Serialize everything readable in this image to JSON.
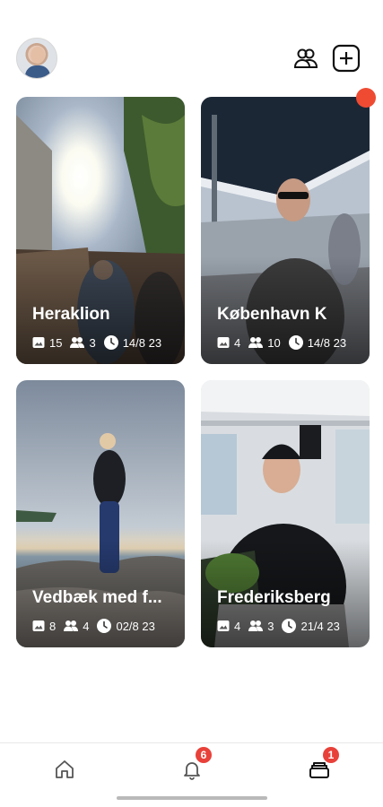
{
  "header": {
    "avatar_icon": "profile-avatar",
    "friends_icon": "people-icon",
    "add_icon": "plus-square-icon"
  },
  "albums": [
    {
      "title": "Heraklion",
      "photos": "15",
      "people": "3",
      "date": "14/8 23"
    },
    {
      "title": "København K",
      "photos": "4",
      "people": "10",
      "date": "14/8 23",
      "unread": true
    },
    {
      "title": "Vedbæk med f...",
      "photos": "8",
      "people": "4",
      "date": "02/8 23"
    },
    {
      "title": "Frederiksberg",
      "photos": "4",
      "people": "3",
      "date": "21/4 23"
    }
  ],
  "tabbar": {
    "home_icon": "home-icon",
    "notifications_icon": "bell-icon",
    "notifications_badge": "6",
    "albums_icon": "stack-icon",
    "albums_badge": "1"
  },
  "colors": {
    "badge": "#e8413a",
    "dot": "#ef4b33",
    "text": "#111111"
  }
}
